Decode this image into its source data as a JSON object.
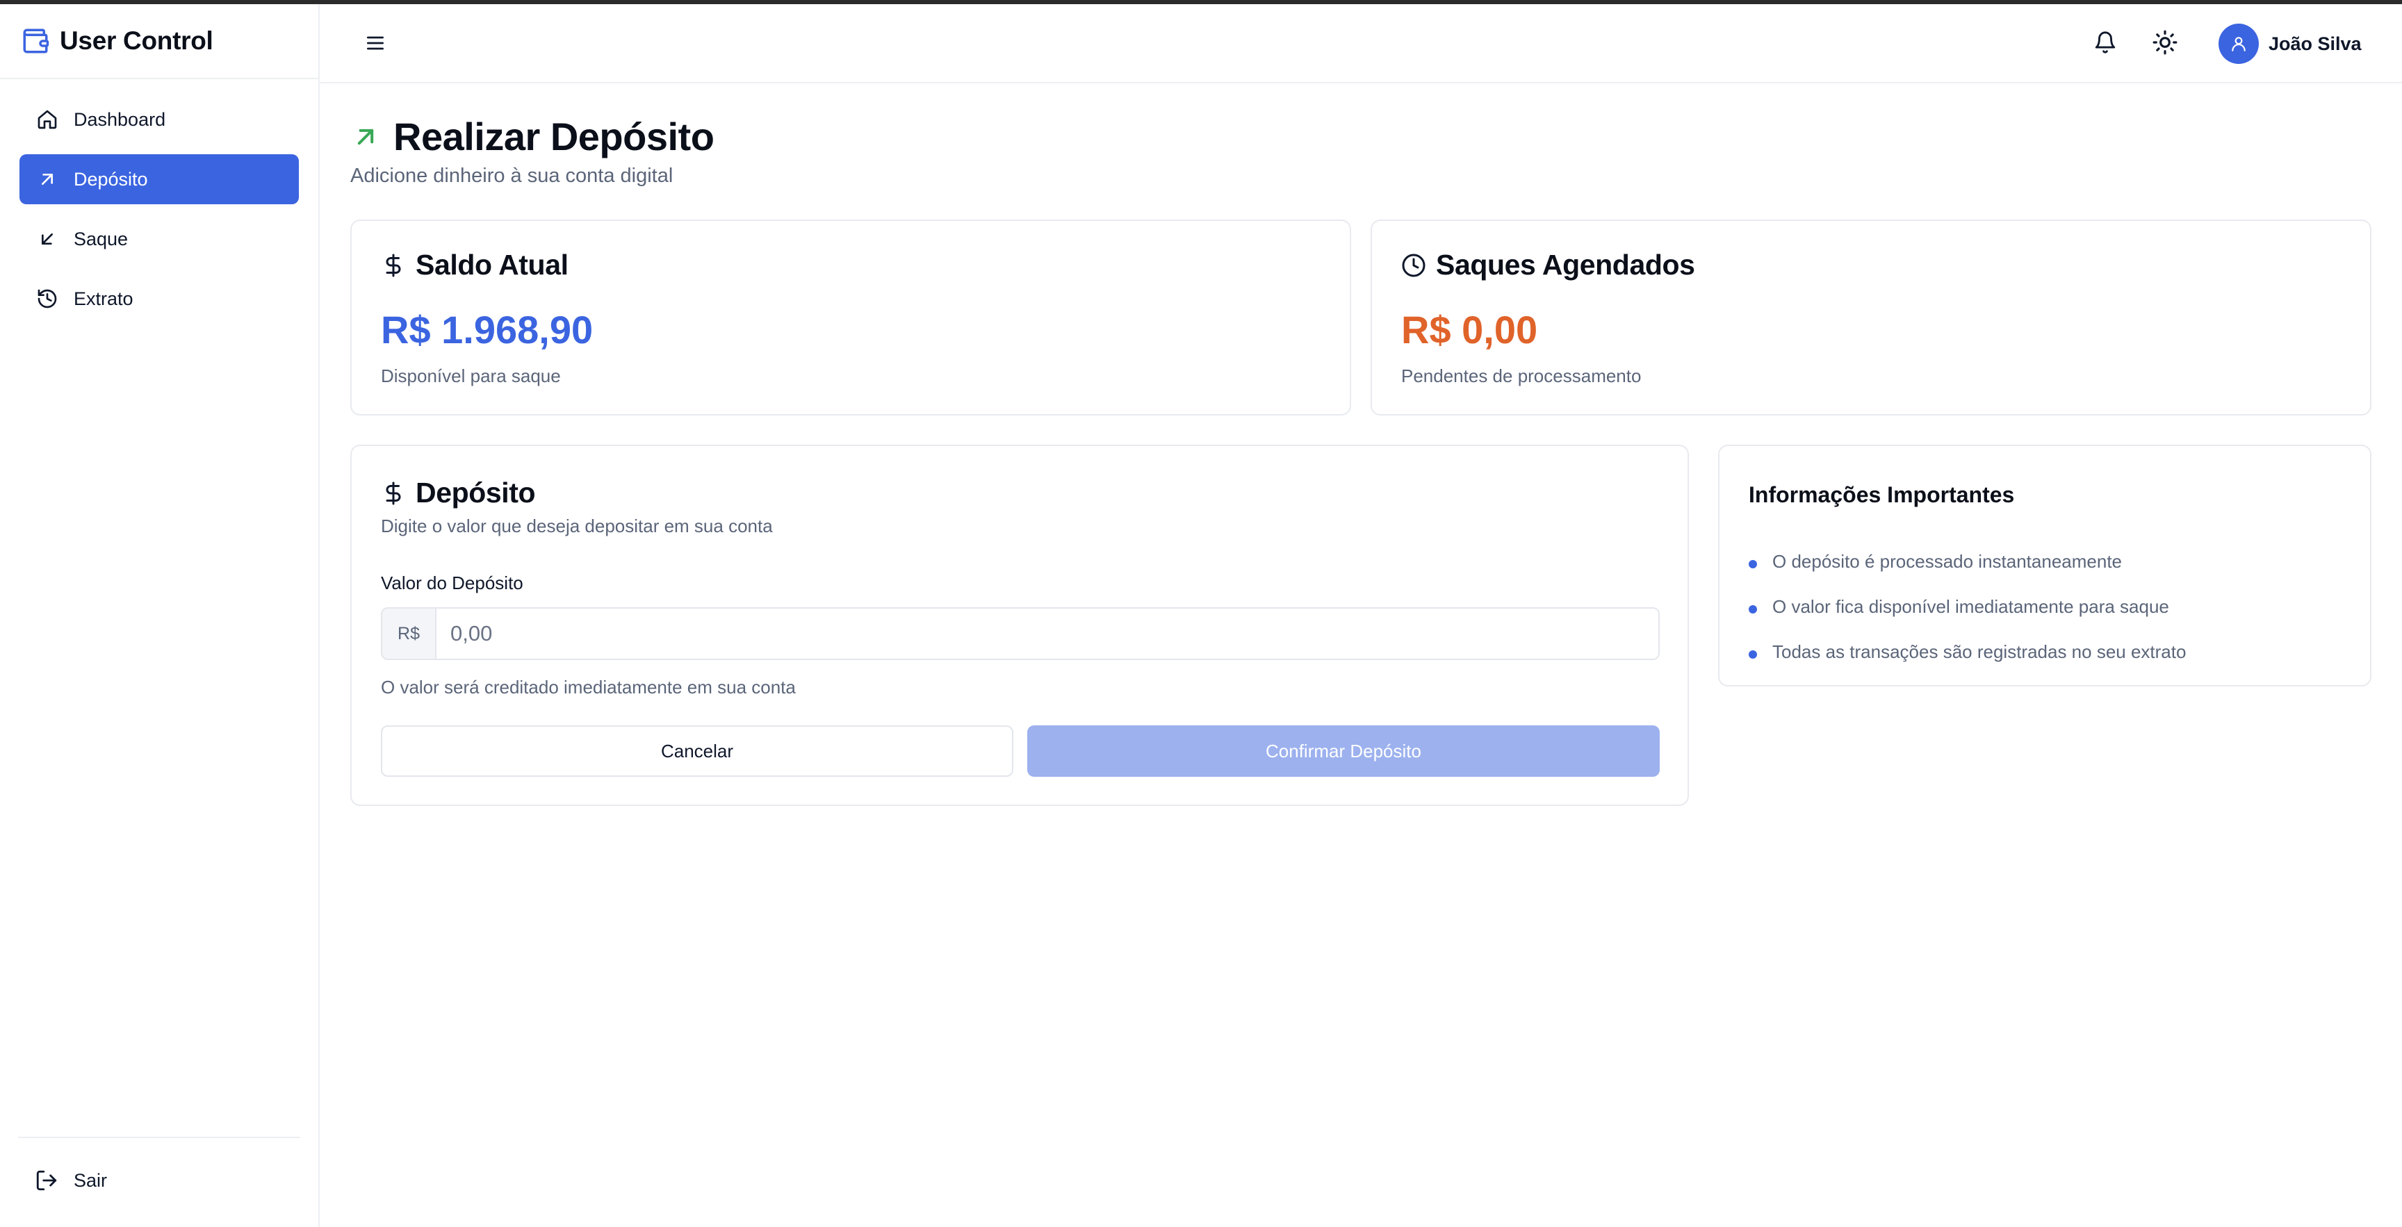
{
  "colors": {
    "primary": "#3b64e0",
    "balance": "#3b64e0",
    "scheduled": "#e0632a",
    "deposit_arrow": "#3aa856",
    "confirm_disabled": "#9cb1ee"
  },
  "sidebar": {
    "brand": "User Control",
    "brand_icon": "wallet-icon",
    "items": [
      {
        "label": "Dashboard",
        "icon": "home-icon",
        "active": false
      },
      {
        "label": "Depósito",
        "icon": "arrow-up-right-icon",
        "active": true
      },
      {
        "label": "Saque",
        "icon": "arrow-down-left-icon",
        "active": false
      },
      {
        "label": "Extrato",
        "icon": "history-icon",
        "active": false
      }
    ],
    "logout": {
      "label": "Sair",
      "icon": "logout-icon"
    }
  },
  "header": {
    "menu_icon": "menu-icon",
    "notification_icon": "bell-icon",
    "theme_icon": "sun-icon",
    "user": {
      "name": "João Silva",
      "icon": "user-icon"
    }
  },
  "page": {
    "title": "Realizar Depósito",
    "subtitle": "Adicione dinheiro à sua conta digital"
  },
  "stats": {
    "balance": {
      "title": "Saldo Atual",
      "value": "R$ 1.968,90",
      "desc": "Disponível para saque",
      "icon": "dollar-icon"
    },
    "scheduled": {
      "title": "Saques Agendados",
      "value": "R$ 0,00",
      "desc": "Pendentes de processamento",
      "icon": "clock-icon"
    }
  },
  "deposit_form": {
    "title": "Depósito",
    "subtitle": "Digite o valor que deseja depositar em sua conta",
    "field_label": "Valor do Depósito",
    "currency_prefix": "R$",
    "placeholder": "0,00",
    "value": "",
    "helper": "O valor será creditado imediatamente em sua conta",
    "cancel_label": "Cancelar",
    "confirm_label": "Confirmar Depósito"
  },
  "info": {
    "title": "Informações Importantes",
    "items": [
      "O depósito é processado instantaneamente",
      "O valor fica disponível imediatamente para saque",
      "Todas as transações são registradas no seu extrato"
    ]
  }
}
